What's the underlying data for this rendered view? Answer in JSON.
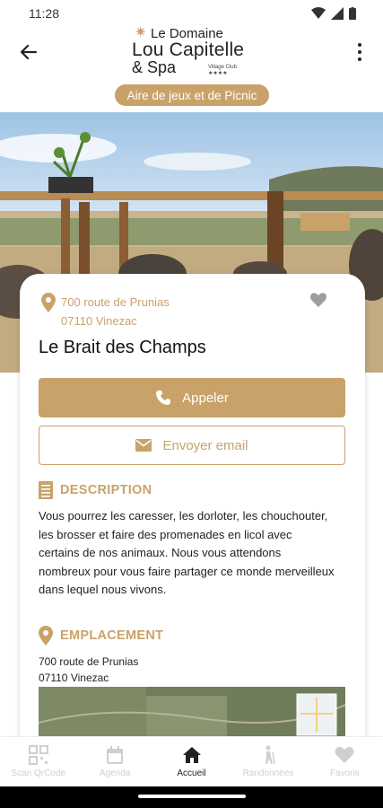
{
  "status": {
    "time": "11:28"
  },
  "header": {
    "logo_line1": "Le Domaine",
    "logo_line2": "Lou Capitelle",
    "logo_line3": "& Spa",
    "logo_tag": "Village Club ★★★★",
    "category": "Aire de jeux et de Picnic"
  },
  "place": {
    "address_line1": "700 route de Prunias",
    "address_line2": "07110 Vinezac",
    "name": "Le Brait des Champs",
    "call_label": "Appeler",
    "email_label": "Envoyer email"
  },
  "description": {
    "heading": "DESCRIPTION",
    "text": "Vous pourrez les caresser, les dorloter, les chouchouter, les brosser et faire des promenades en licol avec certains de nos animaux. Nous vous attendons nombreux pour vous faire partager ce monde merveilleux dans lequel nous vivons."
  },
  "location": {
    "heading": "EMPLACEMENT",
    "line1": "700 route de Prunias",
    "line2": "07110  Vinezac"
  },
  "bottom_nav": [
    {
      "label": "Scan QrCode",
      "icon": "qrcode-icon",
      "active": false
    },
    {
      "label": "Agenda",
      "icon": "calendar-icon",
      "active": false
    },
    {
      "label": "Accueil",
      "icon": "home-icon",
      "active": true
    },
    {
      "label": "Randonnées",
      "icon": "hiker-icon",
      "active": false
    },
    {
      "label": "Favoris",
      "icon": "heart-icon",
      "active": false
    }
  ],
  "colors": {
    "accent": "#c9a26a",
    "inactive": "#cfcfcf"
  }
}
